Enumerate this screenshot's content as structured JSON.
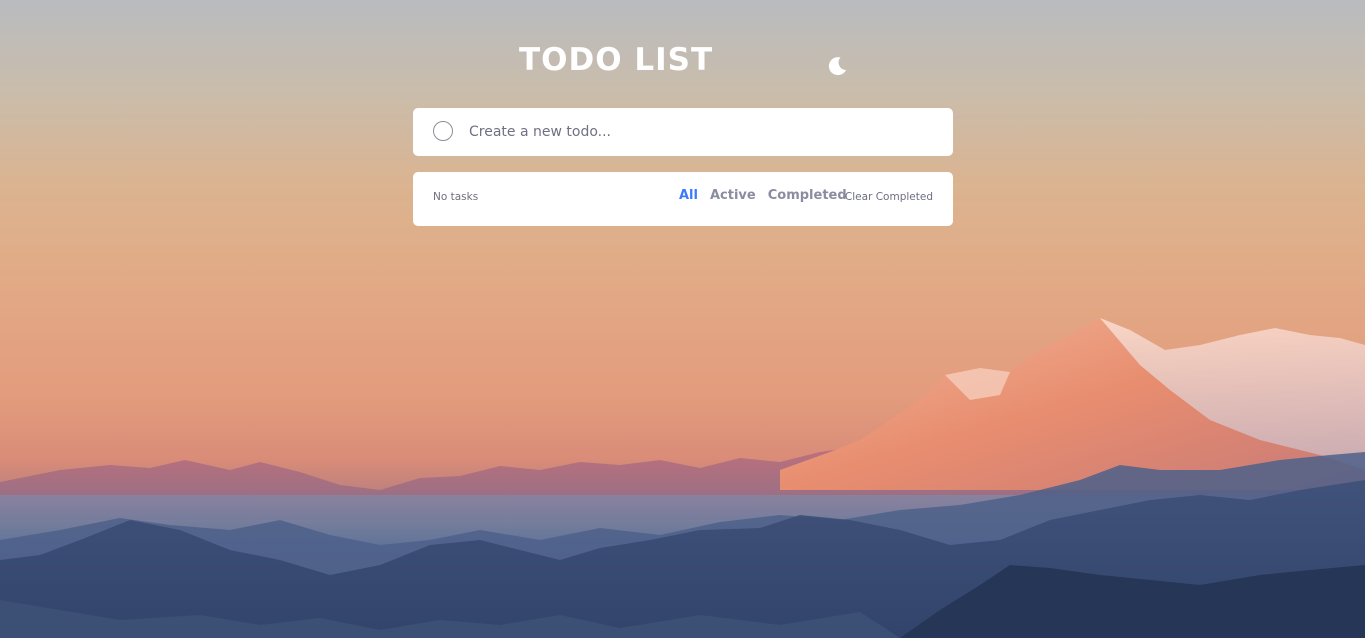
{
  "app": {
    "title": "TODO LIST",
    "theme_toggle_icon": "moon-icon"
  },
  "new_todo": {
    "placeholder": "Create a new todo...",
    "value": "",
    "check_icon": "circle-icon"
  },
  "footer": {
    "count_text": "No tasks",
    "filters": [
      {
        "label": "All",
        "active": true
      },
      {
        "label": "Active",
        "active": false
      },
      {
        "label": "Completed",
        "active": false
      }
    ],
    "clear_label": "Clear Completed"
  },
  "colors": {
    "accent": "#3a7bfd",
    "card": "#ffffff",
    "text_muted": "#6d6f80"
  },
  "background": {
    "image": "mountain-sunset"
  }
}
